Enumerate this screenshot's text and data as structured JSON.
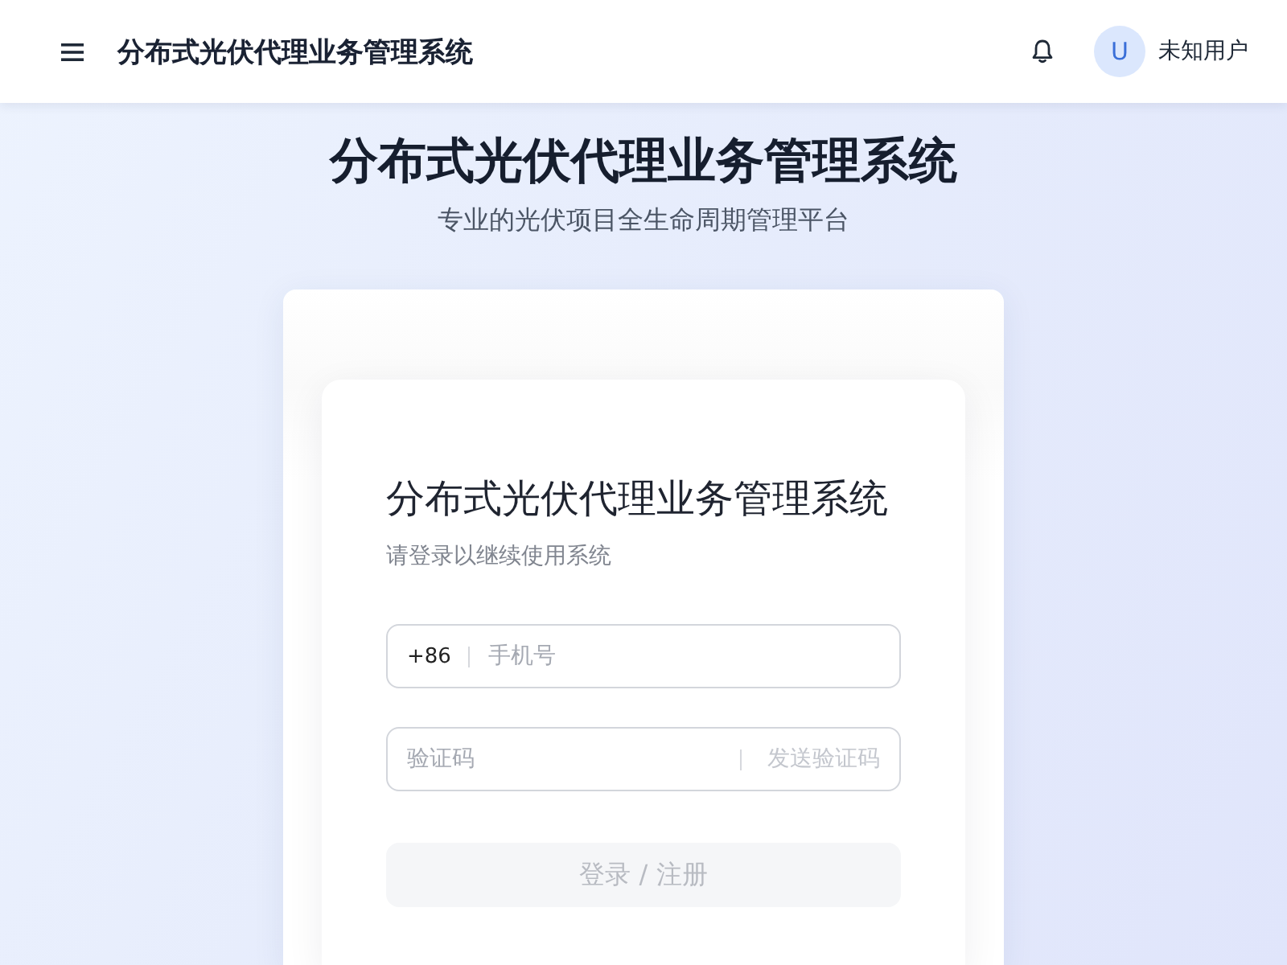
{
  "header": {
    "title": "分布式光伏代理业务管理系统",
    "user": {
      "avatar_letter": "U",
      "name": "未知用户"
    }
  },
  "hero": {
    "title": "分布式光伏代理业务管理系统",
    "subtitle": "专业的光伏项目全生命周期管理平台"
  },
  "login": {
    "title": "分布式光伏代理业务管理系统",
    "subtitle": "请登录以继续使用系统",
    "phone_field": {
      "prefix": "+86",
      "placeholder": "手机号"
    },
    "code_field": {
      "placeholder": "验证码",
      "send_button": {
        "label": "发送验证码",
        "disabled": true
      }
    },
    "submit_button": {
      "label": "登录 / 注册",
      "disabled": true
    }
  }
}
